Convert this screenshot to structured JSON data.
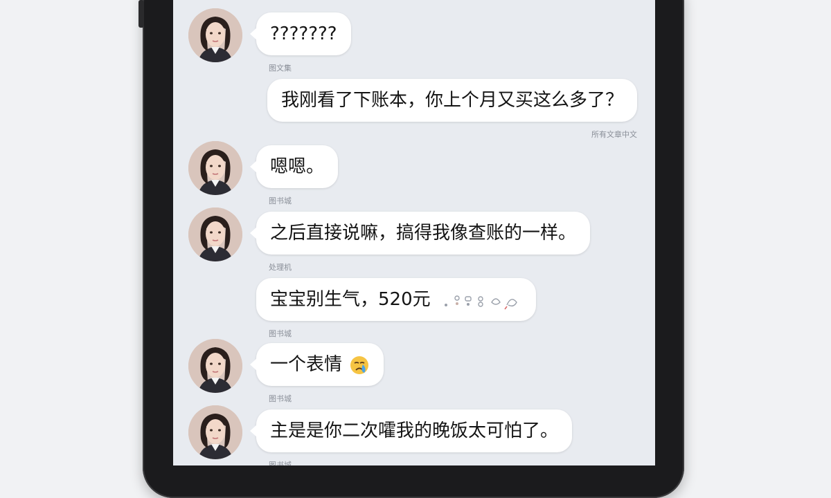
{
  "conversation": {
    "messages": [
      {
        "side": "left",
        "text": "???????",
        "meta": ""
      },
      {
        "side": "right",
        "text": "我刚看了下账本，你上个月又买这么多了？",
        "meta": "所有文章中文"
      },
      {
        "side": "left",
        "text": "嗯嗯。",
        "meta": ""
      },
      {
        "side": "left",
        "text": "之后直接说嘛，搞得我像查账的一样。",
        "meta": ""
      },
      {
        "side": "right",
        "text": "宝宝别生气，520元",
        "meta": ""
      },
      {
        "side": "left",
        "text": "一个表情",
        "meta": "",
        "emoji": "crying-face-emoji"
      },
      {
        "side": "left",
        "text": "主是是你二次嚯我的晚饭太可怕了。",
        "meta": ""
      }
    ],
    "meta_labels": [
      "图文集",
      "",
      "图书城",
      "处理机",
      "图书城",
      "图书城",
      "图书城"
    ]
  },
  "colors": {
    "screen_bg": "#e8ebf0",
    "bubble_bg": "#ffffff",
    "text": "#141414",
    "meta_text": "#8a8f98",
    "frame": "#1b1b1d"
  }
}
